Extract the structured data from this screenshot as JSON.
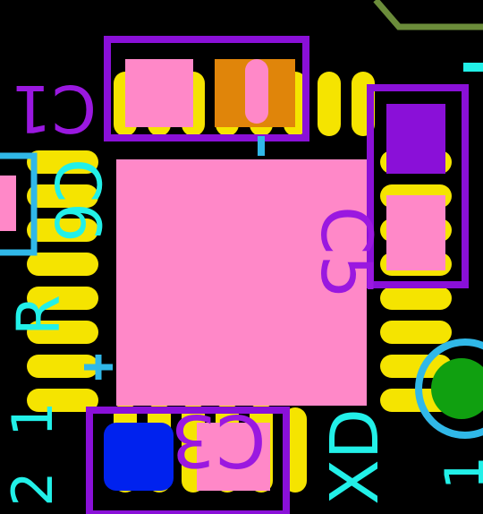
{
  "colors": {
    "background": "#000000",
    "copper_pad": "#f5e400",
    "ic_body": "#ff88c8",
    "pad_pink": "#ff88c8",
    "pad_orange": "#e0850a",
    "pad_purple": "#8a10d8",
    "pad_blue": "#0022ee",
    "outline_purple": "#8a10d8",
    "silk_purple": "#9a18e0",
    "silk_cyan": "#22f0e8",
    "silk_light_blue": "#30b8e8",
    "trace_green": "#6b8c3a",
    "via_green": "#10a010"
  },
  "labels": {
    "c1": "C1",
    "c5": "C5",
    "c3": "C3",
    "c6": "C6",
    "r": "R",
    "one_bottom_left": "1",
    "two": "2",
    "xd": "XD",
    "one_bottom_right": "1"
  }
}
